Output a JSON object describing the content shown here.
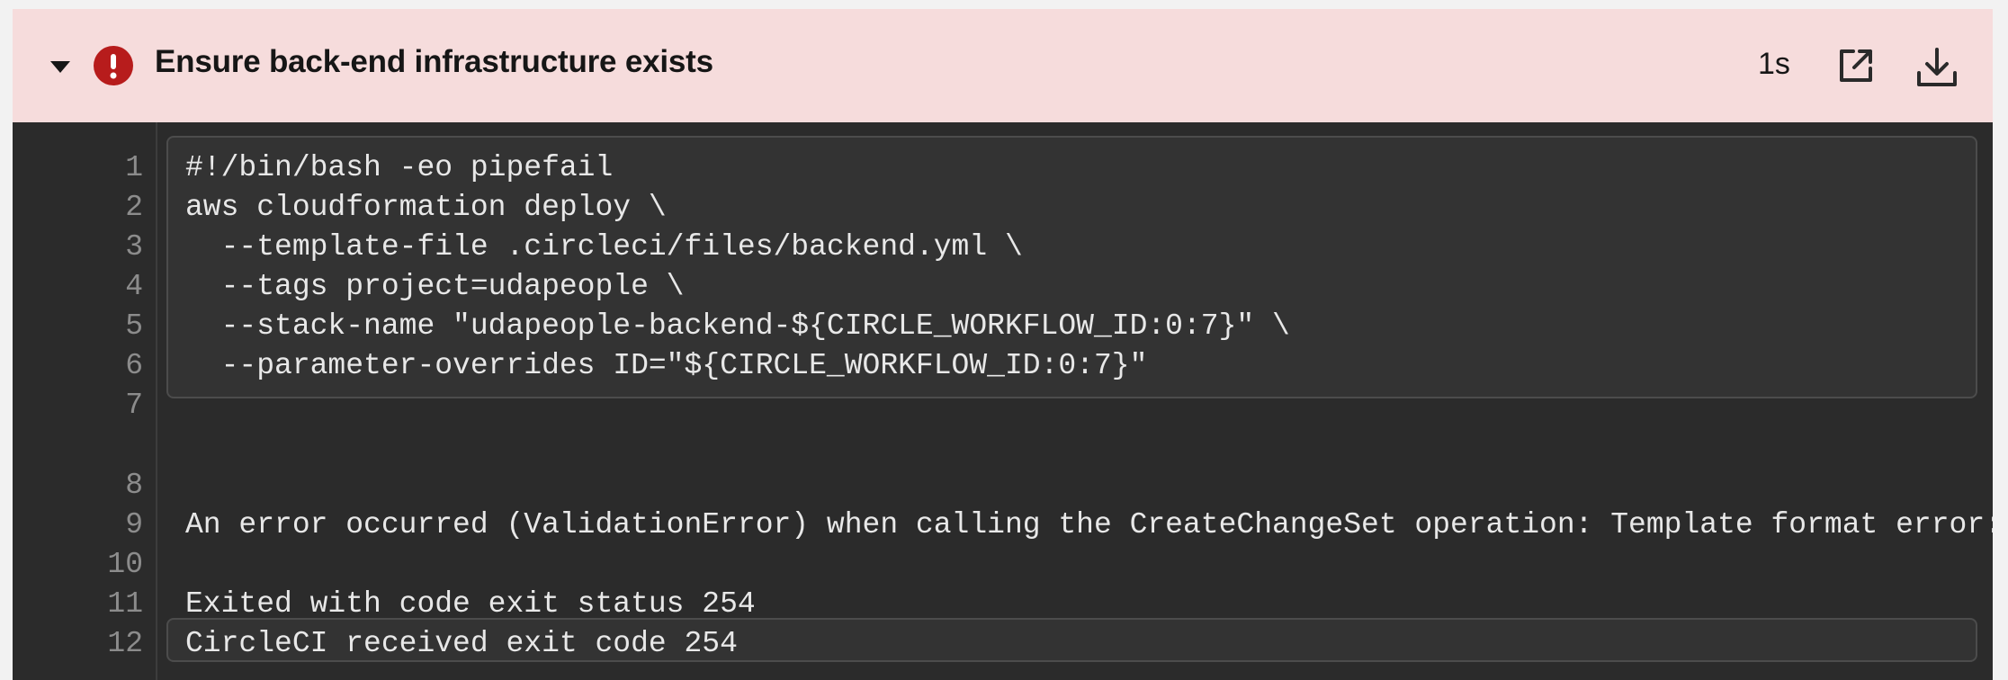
{
  "step": {
    "title": "Ensure back-end infrastructure exists",
    "duration": "1s",
    "status": "failed",
    "header_color": "#f6dcdc",
    "status_color": "#b71c1c"
  },
  "code": {
    "lines": [
      {
        "num": "1",
        "text": "#!/bin/bash -eo pipefail"
      },
      {
        "num": "2",
        "text": "aws cloudformation deploy \\"
      },
      {
        "num": "3",
        "text": "  --template-file .circleci/files/backend.yml \\"
      },
      {
        "num": "4",
        "text": "  --tags project=udapeople \\"
      },
      {
        "num": "5",
        "text": "  --stack-name \"udapeople-backend-${CIRCLE_WORKFLOW_ID:0:7}\" \\"
      },
      {
        "num": "6",
        "text": "  --parameter-overrides ID=\"${CIRCLE_WORKFLOW_ID:0:7}\""
      },
      {
        "num": "7",
        "text": ""
      },
      {
        "num": "8",
        "text": ""
      },
      {
        "num": "9",
        "text": "An error occurred (ValidationError) when calling the CreateChangeSet operation: Template format error: Unreco"
      },
      {
        "num": "10",
        "text": ""
      },
      {
        "num": "11",
        "text": "Exited with code exit status 254"
      },
      {
        "num": "12",
        "text": "CircleCI received exit code 254"
      }
    ]
  },
  "icons": {
    "collapse": "caret-down-icon",
    "status": "error-exclamation-icon",
    "open": "external-link-icon",
    "download": "download-icon"
  }
}
